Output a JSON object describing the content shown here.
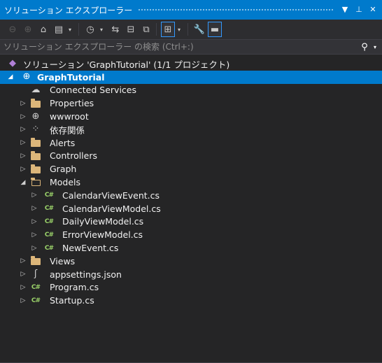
{
  "window": {
    "title": "ソリューション エクスプローラー",
    "buttons": [
      "▼",
      "⊥",
      "✕"
    ]
  },
  "toolbar": {
    "items": [
      {
        "icon": "back-arrow-icon",
        "glyph": "⊖",
        "enabled": false
      },
      {
        "icon": "forward-arrow-icon",
        "glyph": "⊕",
        "enabled": false
      },
      {
        "icon": "home-icon",
        "glyph": "⌂",
        "enabled": true
      },
      {
        "icon": "switch-views-icon",
        "glyph": "▤",
        "enabled": true
      },
      {
        "icon": "pending-changes-icon",
        "glyph": "◷",
        "enabled": true
      },
      {
        "icon": "sync-icon",
        "glyph": "⇆",
        "enabled": true
      },
      {
        "icon": "collapse-all-icon",
        "glyph": "⊟",
        "enabled": true
      },
      {
        "icon": "show-all-files-icon",
        "glyph": "⧉",
        "enabled": true
      },
      {
        "icon": "preview-selected-icon",
        "glyph": "⊞",
        "enabled": true
      },
      {
        "icon": "properties-wrench-icon",
        "glyph": "🔧",
        "enabled": true
      },
      {
        "icon": "preview-toggle-icon",
        "glyph": "▬",
        "enabled": true
      }
    ]
  },
  "search": {
    "placeholder": "ソリューション エクスプローラー の検索 (Ctrl+:)"
  },
  "tree": [
    {
      "label": "ソリューション 'GraphTutorial' (1/1 プロジェクト)",
      "icon": "solution-icon",
      "glyph": "◆",
      "indent": 0,
      "expander": "",
      "selected": false
    },
    {
      "label": "GraphTutorial",
      "icon": "web-project-icon",
      "glyph": "⊕",
      "indent": 0,
      "expander": "◢",
      "selected": true,
      "bold": true
    },
    {
      "label": "Connected Services",
      "icon": "connected-services-icon",
      "glyph": "☁",
      "indent": 1,
      "expander": "",
      "selected": false
    },
    {
      "label": "Properties",
      "icon": "properties-folder-icon",
      "glyph": "folder",
      "indent": 1,
      "expander": "▷",
      "selected": false
    },
    {
      "label": "wwwroot",
      "icon": "globe-icon",
      "glyph": "⊕",
      "indent": 1,
      "expander": "▷",
      "selected": false
    },
    {
      "label": "依存関係",
      "icon": "dependencies-icon",
      "glyph": "⁘",
      "indent": 1,
      "expander": "▷",
      "selected": false
    },
    {
      "label": "Alerts",
      "icon": "folder-icon",
      "glyph": "folder",
      "indent": 1,
      "expander": "▷",
      "selected": false
    },
    {
      "label": "Controllers",
      "icon": "folder-icon",
      "glyph": "folder",
      "indent": 1,
      "expander": "▷",
      "selected": false
    },
    {
      "label": "Graph",
      "icon": "folder-icon",
      "glyph": "folder",
      "indent": 1,
      "expander": "▷",
      "selected": false
    },
    {
      "label": "Models",
      "icon": "open-folder-icon",
      "glyph": "folder-open",
      "indent": 1,
      "expander": "◢",
      "selected": false
    },
    {
      "label": "CalendarViewEvent.cs",
      "icon": "csharp-file-icon",
      "glyph": "C#",
      "indent": 2,
      "expander": "▷",
      "selected": false
    },
    {
      "label": "CalendarViewModel.cs",
      "icon": "csharp-file-icon",
      "glyph": "C#",
      "indent": 2,
      "expander": "▷",
      "selected": false
    },
    {
      "label": "DailyViewModel.cs",
      "icon": "csharp-file-icon",
      "glyph": "C#",
      "indent": 2,
      "expander": "▷",
      "selected": false
    },
    {
      "label": "ErrorViewModel.cs",
      "icon": "csharp-file-icon",
      "glyph": "C#",
      "indent": 2,
      "expander": "▷",
      "selected": false
    },
    {
      "label": "NewEvent.cs",
      "icon": "csharp-file-icon",
      "glyph": "C#",
      "indent": 2,
      "expander": "▷",
      "selected": false
    },
    {
      "label": "Views",
      "icon": "folder-icon",
      "glyph": "folder",
      "indent": 1,
      "expander": "▷",
      "selected": false
    },
    {
      "label": "appsettings.json",
      "icon": "json-file-icon",
      "glyph": "ʃ",
      "indent": 1,
      "expander": "▷",
      "selected": false
    },
    {
      "label": "Program.cs",
      "icon": "csharp-file-icon",
      "glyph": "C#",
      "indent": 1,
      "expander": "▷",
      "selected": false
    },
    {
      "label": "Startup.cs",
      "icon": "csharp-file-icon",
      "glyph": "C#",
      "indent": 1,
      "expander": "▷",
      "selected": false
    }
  ],
  "colors": {
    "accent": "#007acc",
    "background": "#252526",
    "folder": "#dcb67a",
    "csharp": "#9bd36a"
  }
}
